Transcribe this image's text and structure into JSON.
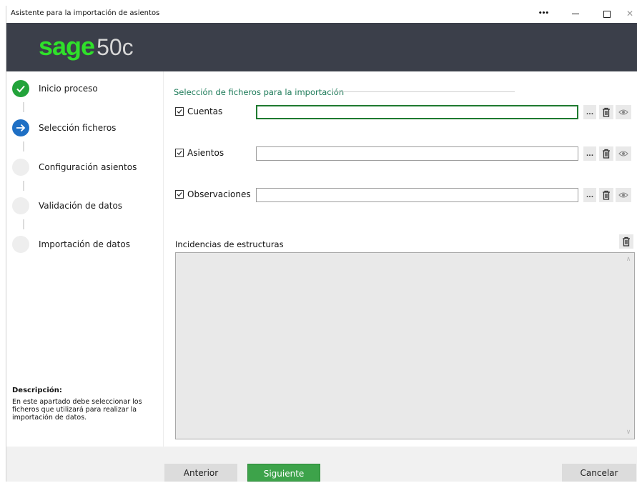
{
  "window": {
    "title": "Asistente para la importación de asientos",
    "more_label": "•••",
    "close_label": "✕"
  },
  "header": {
    "brand": "sage",
    "version": "50c",
    "brand_color": "#2fe02a",
    "background": "#3b3f4a"
  },
  "steps": [
    {
      "label": "Inicio proceso",
      "state": "done",
      "icon": "check-icon"
    },
    {
      "label": "Selección ficheros",
      "state": "active",
      "icon": "arrow-right-icon"
    },
    {
      "label": "Configuración asientos",
      "state": "pending",
      "icon": ""
    },
    {
      "label": "Validación de datos",
      "state": "pending",
      "icon": ""
    },
    {
      "label": "Importación de datos",
      "state": "pending",
      "icon": ""
    }
  ],
  "description": {
    "title": "Descripción:",
    "text": "En este apartado debe seleccionar los ficheros que utilizará para realizar la importación de datos."
  },
  "main": {
    "section_title": "Selección de ficheros para la importación",
    "files": [
      {
        "label": "Cuentas",
        "checked": true,
        "value": "",
        "browse": "...",
        "focused": true
      },
      {
        "label": "Asientos",
        "checked": true,
        "value": "",
        "browse": "...",
        "focused": false
      },
      {
        "label": "Observaciones",
        "checked": true,
        "value": "",
        "browse": "...",
        "focused": false
      }
    ],
    "incidencias_label": "Incidencias de estructuras",
    "scroll_up": "∧",
    "scroll_down": "∨"
  },
  "footer": {
    "prev_label": "Anterior",
    "next_label": "Siguiente",
    "cancel_label": "Cancelar",
    "accent": "#3da34a"
  }
}
